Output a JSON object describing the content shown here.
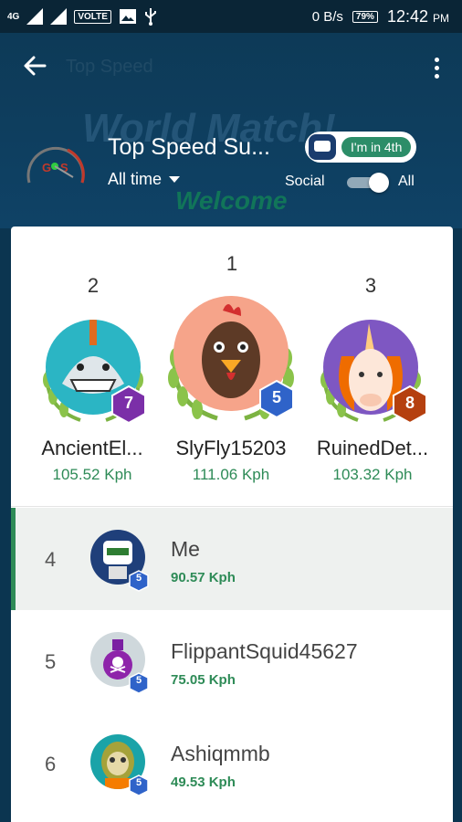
{
  "status_bar": {
    "network": "4G",
    "volte": "VOLTE",
    "speed": "0 B/s",
    "battery": "79%",
    "time": "12:42",
    "ampm": "PM"
  },
  "header": {
    "dim_title": "Top Speed",
    "watermark_world": "World Match!",
    "watermark_welcome": "Welcome",
    "leaderboard_title": "Top Speed Su...",
    "period": "All time",
    "rank_pill": "I'm in 4th",
    "toggle_left": "Social",
    "toggle_right": "All",
    "toggle_state": "All"
  },
  "podium": [
    {
      "place": "2",
      "name": "AncientEl...",
      "speed": "105.52 Kph",
      "level": "7",
      "badge_color": "#7b2fa8"
    },
    {
      "place": "1",
      "name": "SlyFly15203",
      "speed": "111.06 Kph",
      "level": "5",
      "badge_color": "#2f63c9"
    },
    {
      "place": "3",
      "name": "RuinedDet...",
      "speed": "103.32 Kph",
      "level": "8",
      "badge_color": "#b5400f"
    }
  ],
  "rows": [
    {
      "rank": "4",
      "name": "Me",
      "speed": "90.57 Kph",
      "level": "5",
      "highlight": true
    },
    {
      "rank": "5",
      "name": "FlippantSquid45627",
      "speed": "75.05 Kph",
      "level": "5",
      "highlight": false
    },
    {
      "rank": "6",
      "name": "Ashiqmmb",
      "speed": "49.53 Kph",
      "level": "5",
      "highlight": false
    }
  ],
  "colors": {
    "accent_green": "#2e8b57",
    "header_bg": "#0d3a57",
    "pill_green": "#2c8d68"
  }
}
